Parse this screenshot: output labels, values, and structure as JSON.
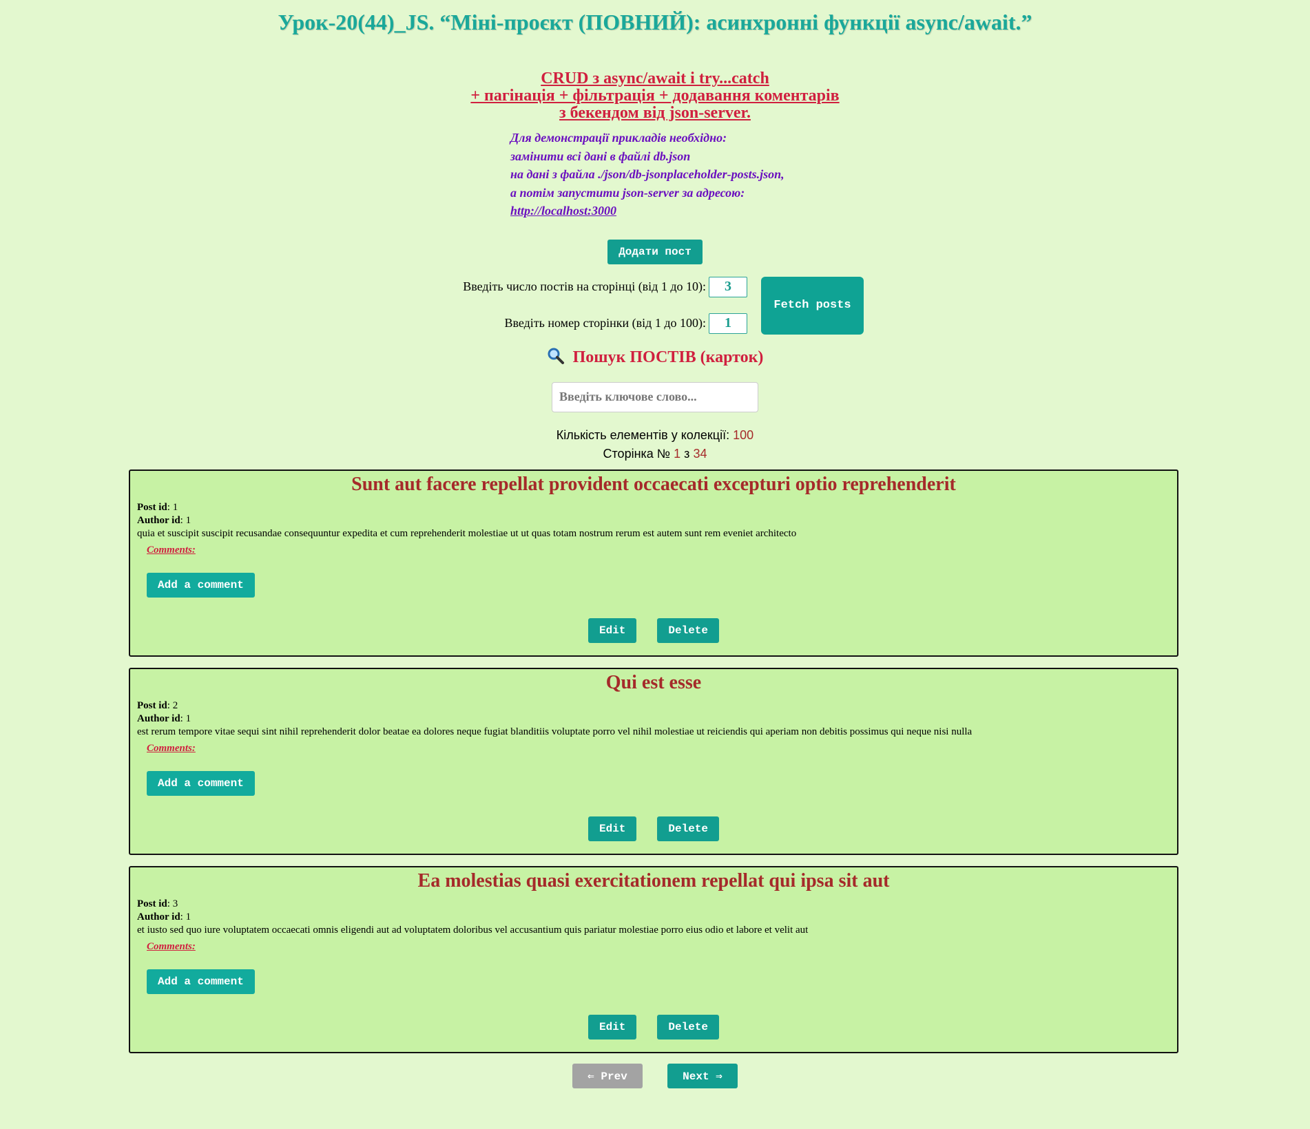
{
  "page": {
    "title": "Урок-20(44)_JS. “Міні-проєкт (ПОВНИЙ): асинхронні функції async/await.”"
  },
  "subtitle": {
    "line1": "CRUD з async/await і try...catch",
    "line2": "+ пагінація + фільтрація + додавання коментарів",
    "line3": "з бекендом від json-server."
  },
  "note": {
    "line1": "Для демонстрації прикладів необхідно:",
    "line2": "замінити всі дані в файлі db.json",
    "line3": "на дані з файла ./json/db-jsonplaceholder-posts.json,",
    "line4": "а потім запустити json-server за адресою:",
    "link": "http://localhost:3000"
  },
  "controls": {
    "add_post_label": "Додати пост",
    "per_page_label": "Введіть число постів на сторінці (від 1 до 10):",
    "per_page_value": "3",
    "page_label": "Введіть номер сторінки (від 1 до 100):",
    "page_value": "1",
    "fetch_label": "Fetch posts"
  },
  "search": {
    "title": "Пошук ПОСТІВ (карток)",
    "placeholder": "Введіть ключове слово..."
  },
  "stats": {
    "count_label": "Кількість елементів у колекції:",
    "count_value": "100",
    "page_prefix": "Сторінка №",
    "page_current": "1",
    "page_sep": "з",
    "page_total": "34"
  },
  "card_labels": {
    "post_id": "Post id",
    "author_id": "Author id",
    "comments": "Comments:",
    "add_comment": "Add a comment",
    "edit": "Edit",
    "delete": "Delete"
  },
  "posts": [
    {
      "title": "Sunt aut facere repellat provident occaecati excepturi optio reprehenderit",
      "id": "1",
      "author": "1",
      "body": "quia et suscipit suscipit recusandae consequuntur expedita et cum reprehenderit molestiae ut ut quas totam nostrum rerum est autem sunt rem eveniet architecto"
    },
    {
      "title": "Qui est esse",
      "id": "2",
      "author": "1",
      "body": "est rerum tempore vitae sequi sint nihil reprehenderit dolor beatae ea dolores neque fugiat blanditiis voluptate porro vel nihil molestiae ut reiciendis qui aperiam non debitis possimus qui neque nisi nulla"
    },
    {
      "title": "Ea molestias quasi exercitationem repellat qui ipsa sit aut",
      "id": "3",
      "author": "1",
      "body": "et iusto sed quo iure voluptatem occaecati omnis eligendi aut ad voluptatem doloribus vel accusantium quis pariatur molestiae porro eius odio et labore et velit aut"
    }
  ],
  "pager": {
    "prev_label": "⇐ Prev",
    "next_label": "Next ⇒"
  },
  "icons": {
    "search": "magnifier-icon"
  },
  "colors": {
    "background": "#e3f8cf",
    "card": "#c7f2a4",
    "accent": "#129e90",
    "title": "#1aa89a",
    "red": "#d0203f",
    "purple": "#6a0fbf",
    "card_title": "#a52a2a",
    "disabled": "#a3a3a3"
  }
}
